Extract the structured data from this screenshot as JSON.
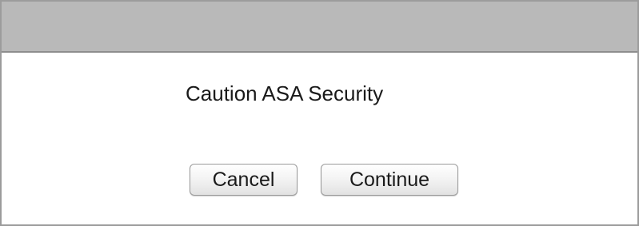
{
  "dialog": {
    "message": "Caution ASA Security",
    "buttons": {
      "cancel_label": "Cancel",
      "continue_label": "Continue"
    }
  },
  "colors": {
    "titlebar": "#b9b9b9",
    "border": "#9c9c9c",
    "background": "#ffffff"
  }
}
